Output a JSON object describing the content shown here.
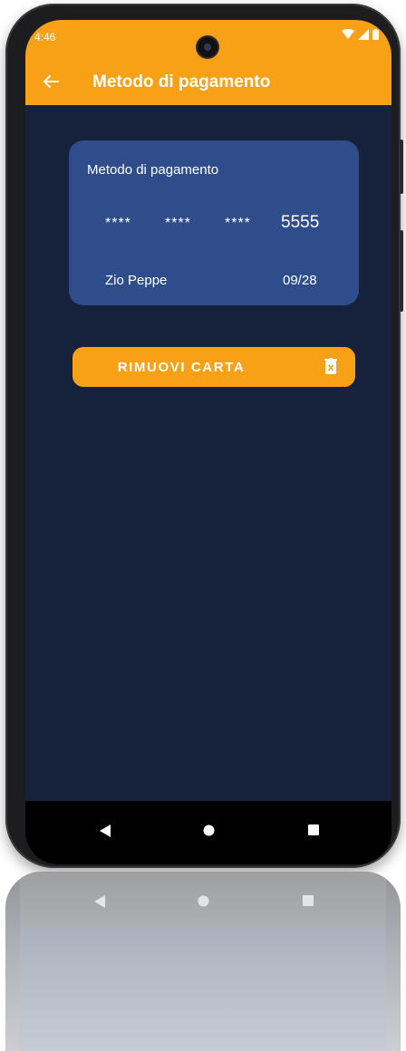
{
  "status": {
    "time": "4:46",
    "icons": [
      "wifi-icon",
      "signal-icon",
      "battery-icon"
    ]
  },
  "appbar": {
    "title": "Metodo di pagamento",
    "back_icon": "arrow-left-icon"
  },
  "card": {
    "label": "Metodo di pagamento",
    "mask_groups": [
      "****",
      "****",
      "****"
    ],
    "last4": "5555",
    "holder": "Zio Peppe",
    "expiry": "09/28"
  },
  "remove_button": {
    "label": "RIMUOVI CARTA",
    "icon": "trash-icon"
  },
  "navbar": {
    "icons": [
      "back-triangle-icon",
      "home-circle-icon",
      "recents-square-icon"
    ]
  },
  "colors": {
    "accent": "#f8a016",
    "background": "#16223c",
    "card": "#2f4d8b",
    "navbar": "#000000"
  }
}
